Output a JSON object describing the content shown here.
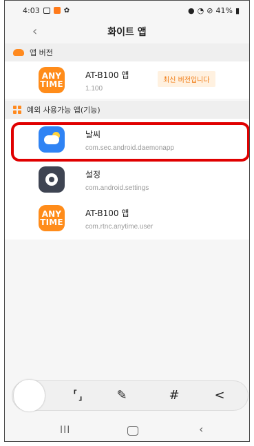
{
  "status": {
    "time": "4:03",
    "battery": "41%"
  },
  "appbar": {
    "title": "화이트 앱",
    "back": "‹"
  },
  "version_section": {
    "header": "앱 버전",
    "app": {
      "name": "AT-B100 앱",
      "version": "1.100",
      "badge": "최신 버전입니다",
      "icon_line1": "ANY",
      "icon_line2": "TIME"
    }
  },
  "exception_section": {
    "header": "예외 사용가능 앱(기능)",
    "items": [
      {
        "name": "날씨",
        "package": "com.sec.android.daemonapp",
        "icon": "weather-icon"
      },
      {
        "name": "설정",
        "package": "com.android.settings",
        "icon": "settings-gear-icon"
      },
      {
        "name": "AT-B100 앱",
        "package": "com.rtnc.anytime.user",
        "icon": "anytime-icon",
        "icon_line1": "ANY",
        "icon_line2": "TIME"
      }
    ]
  },
  "toolbar": {
    "scan": "⸢⸥",
    "edit": "✎",
    "hash": "#",
    "share": "<"
  },
  "navbar": {
    "recents": "III",
    "back": "‹"
  }
}
